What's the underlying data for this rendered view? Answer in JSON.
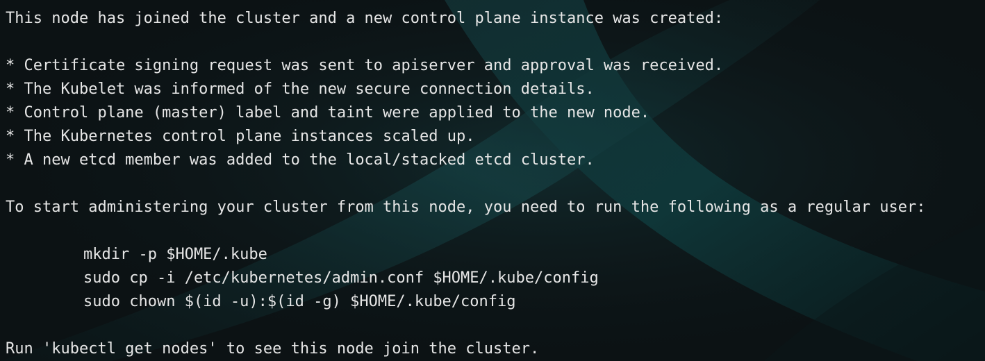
{
  "terminal": {
    "header": "This node has joined the cluster and a new control plane instance was created:",
    "bullets": [
      "* Certificate signing request was sent to apiserver and approval was received.",
      "* The Kubelet was informed of the new secure connection details.",
      "* Control plane (master) label and taint were applied to the new node.",
      "* The Kubernetes control plane instances scaled up.",
      "* A new etcd member was added to the local/stacked etcd cluster."
    ],
    "instructions": "To start administering your cluster from this node, you need to run the following as a regular user:",
    "commands": [
      "mkdir -p $HOME/.kube",
      "sudo cp -i /etc/kubernetes/admin.conf $HOME/.kube/config",
      "sudo chown $(id -u):$(id -g) $HOME/.kube/config"
    ],
    "footer": "Run 'kubectl get nodes' to see this node join the cluster."
  },
  "colors": {
    "background": "#0c1214",
    "text": "#e6e6e6",
    "accent_teal": "#1f4f52"
  }
}
